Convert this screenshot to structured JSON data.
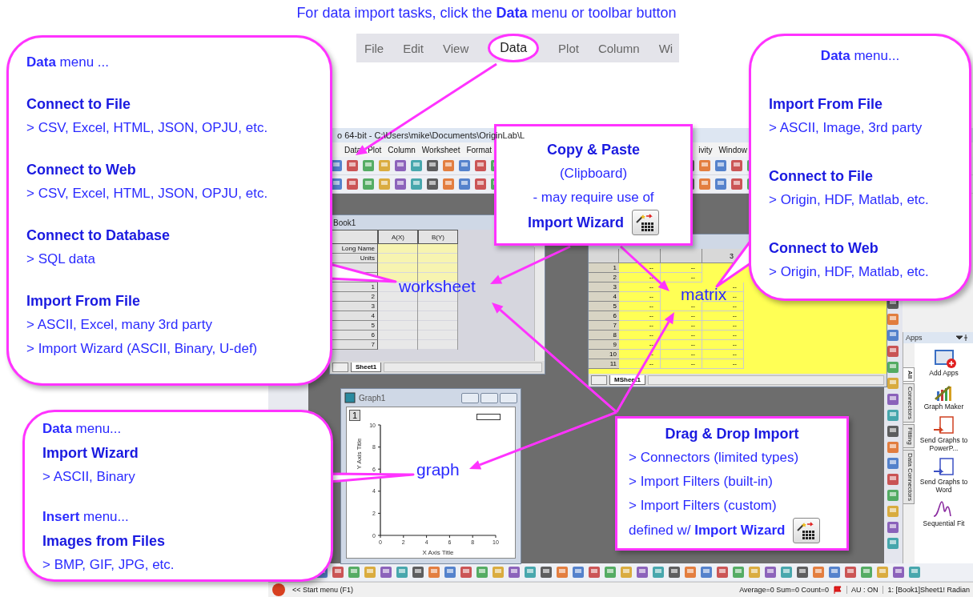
{
  "heading": "For data import tasks, click the **Data** menu or toolbar button",
  "menu_strip": [
    {
      "label": "File",
      "selected": false
    },
    {
      "label": "Edit",
      "selected": false
    },
    {
      "label": "View",
      "selected": false
    },
    {
      "label": "Data",
      "selected": true
    },
    {
      "label": "Plot",
      "selected": false
    },
    {
      "label": "Column",
      "selected": false
    },
    {
      "label": "Wi",
      "selected": false
    }
  ],
  "app": {
    "title": "o 64-bit - C:\\Users\\mike\\Documents\\OriginLab\\L",
    "menus_left": [
      "Data",
      "Plot",
      "Column",
      "Worksheet",
      "Format"
    ],
    "menus_right": [
      "ivity",
      "Window"
    ],
    "worksheet": {
      "title": "Book1",
      "columns": [
        "A(X)",
        "B(Y)"
      ],
      "sheet_tab": "Sheet1",
      "rows": [
        {
          "label": "Long Name",
          "kind": "meta"
        },
        {
          "label": "Units",
          "kind": "meta"
        },
        {
          "kind": "meta"
        },
        {
          "kind": "meta"
        },
        {
          "label": "1",
          "kind": "data"
        },
        {
          "label": "2",
          "kind": "data"
        },
        {
          "label": "3",
          "kind": "data"
        },
        {
          "label": "4",
          "kind": "data"
        },
        {
          "label": "5",
          "kind": "data"
        },
        {
          "label": "6",
          "kind": "data"
        },
        {
          "label": "7",
          "kind": "data"
        }
      ]
    },
    "matrix": {
      "column_headers": [
        "3"
      ],
      "sheet_tab": "MSheet1",
      "rows": [
        {
          "label": "1",
          "cells": [
            "--",
            "--",
            null
          ]
        },
        {
          "label": "2",
          "cells": [
            "--",
            "--",
            null
          ]
        },
        {
          "label": "3",
          "cells": [
            "--",
            null,
            "--"
          ]
        },
        {
          "label": "4",
          "cells": [
            "--",
            null,
            "--"
          ]
        },
        {
          "label": "5",
          "cells": [
            "--",
            "--",
            "--"
          ]
        },
        {
          "label": "6",
          "cells": [
            "--",
            "--",
            "--"
          ]
        },
        {
          "label": "7",
          "cells": [
            "--",
            "--",
            "--"
          ]
        },
        {
          "label": "8",
          "cells": [
            "--",
            "--",
            "--"
          ]
        },
        {
          "label": "9",
          "cells": [
            "--",
            "--",
            "--"
          ]
        },
        {
          "label": "10",
          "cells": [
            "--",
            "--",
            "--"
          ]
        },
        {
          "label": "11",
          "cells": [
            "--",
            "--",
            "--"
          ]
        }
      ]
    },
    "graph": {
      "title": "Graph1",
      "layer": "1",
      "xlabel": "X Axis Title",
      "ylabel": "Y Axis Title",
      "xticks": [
        "0",
        "2",
        "4",
        "6",
        "8",
        "10"
      ],
      "yticks": [
        "10",
        "8",
        "6",
        "4",
        "2",
        "0"
      ]
    },
    "apps": {
      "title": "Apps",
      "tabs": [
        {
          "label": "All",
          "selected": true
        },
        {
          "label": "Connectors",
          "selected": false
        },
        {
          "label": "Fitting",
          "selected": false
        },
        {
          "label": "Data Connectors",
          "selected": false
        }
      ],
      "items": [
        {
          "label": "Add Apps",
          "kind": "add"
        },
        {
          "label": "Graph Maker",
          "kind": "graph"
        },
        {
          "label": "Send Graphs to PowerP...",
          "kind": "slides"
        },
        {
          "label": "Send Graphs to Word",
          "kind": "doc"
        },
        {
          "label": "Sequential Fit",
          "kind": "fit"
        }
      ]
    },
    "status_bar": {
      "start": "<< Start menu (F1)",
      "stats": "Average=0 Sum=0 Count=0",
      "au": "AU : ON",
      "sheet": "1: [Book1]Sheet1! Radian"
    }
  },
  "labels": [
    "worksheet",
    "matrix",
    "graph"
  ],
  "callouts": [
    {
      "groups": [
        [
          {
            "kind": "rich",
            "text": "**Data** menu ..."
          }
        ],
        [
          {
            "kind": "heading",
            "text": "Connect to File"
          },
          {
            "kind": "text",
            "text": "> CSV, Excel, HTML, JSON, OPJU, etc."
          }
        ],
        [
          {
            "kind": "heading",
            "text": "Connect to Web"
          },
          {
            "kind": "text",
            "text": "> CSV, Excel, HTML, JSON, OPJU, etc."
          }
        ],
        [
          {
            "kind": "heading",
            "text": "Connect to Database"
          },
          {
            "kind": "text",
            "text": "> SQL data"
          }
        ],
        [
          {
            "kind": "heading",
            "text": "Import From File"
          },
          {
            "kind": "text",
            "text": "> ASCII, Excel, many 3rd party"
          },
          {
            "kind": "text",
            "text": "> Import Wizard (ASCII, Binary, U-def)"
          }
        ]
      ]
    },
    {
      "groups": [
        [
          {
            "kind": "rich",
            "text": "**Data** menu..."
          },
          {
            "kind": "heading",
            "text": "Import Wizard"
          },
          {
            "kind": "text",
            "text": "> ASCII, Binary"
          }
        ],
        [
          {
            "kind": "rich",
            "text": "**Insert** menu..."
          },
          {
            "kind": "heading",
            "text": "Images from Files"
          },
          {
            "kind": "text",
            "text": "> BMP, GIF, JPG, etc."
          }
        ]
      ]
    },
    {
      "groups": [
        [
          {
            "kind": "heading",
            "text": "Copy & Paste"
          },
          {
            "kind": "text",
            "text": "(Clipboard)"
          },
          {
            "kind": "text",
            "text": "- may require use of"
          },
          {
            "kind": "wizardheading",
            "text": "Import Wizard"
          }
        ]
      ]
    },
    {
      "groups": [
        [
          {
            "kind": "rich",
            "text": "**Data** menu..."
          }
        ],
        [
          {
            "kind": "heading",
            "text": "Import From File"
          },
          {
            "kind": "text",
            "text": "> ASCII, Image, 3rd party"
          }
        ],
        [
          {
            "kind": "heading",
            "text": "Connect to File"
          },
          {
            "kind": "text",
            "text": "> Origin, HDF, Matlab, etc."
          }
        ],
        [
          {
            "kind": "heading",
            "text": "Connect to Web"
          },
          {
            "kind": "text",
            "text": "> Origin, HDF, Matlab, etc."
          }
        ]
      ]
    },
    {
      "groups": [
        [
          {
            "kind": "heading",
            "text": "Drag & Drop Import"
          },
          {
            "kind": "text",
            "text": "> Connectors (limited types)"
          },
          {
            "kind": "text",
            "text": "> Import Filters (built-in)"
          },
          {
            "kind": "text",
            "text": "> Import Filters (custom)"
          },
          {
            "kind": "wizardrich",
            "text": "defined w/ **Import Wizard**"
          }
        ]
      ]
    }
  ]
}
